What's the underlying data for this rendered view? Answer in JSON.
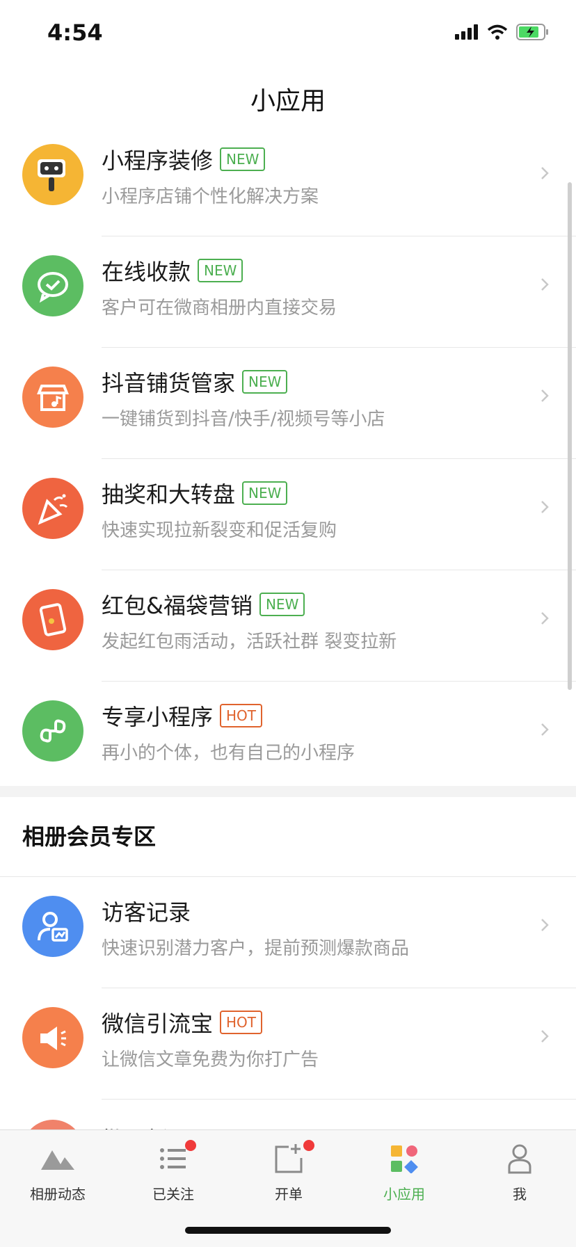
{
  "status": {
    "time": "4:54"
  },
  "page_title": "小应用",
  "apps": [
    {
      "name": "小程序装修",
      "badge": "NEW",
      "badge_type": "new",
      "desc": "小程序店铺个性化解决方案",
      "color": "#f5b534",
      "icon": "robot-icon"
    },
    {
      "name": "在线收款",
      "badge": "NEW",
      "badge_type": "new",
      "desc": "客户可在微商相册内直接交易",
      "color": "#5cbd62",
      "icon": "chat-check-icon"
    },
    {
      "name": "抖音铺货管家",
      "badge": "NEW",
      "badge_type": "new",
      "desc": "一键铺货到抖音/快手/视频号等小店",
      "color": "#f5804c",
      "icon": "shop-music-icon"
    },
    {
      "name": "抽奖和大转盘",
      "badge": "NEW",
      "badge_type": "new",
      "desc": "快速实现拉新裂变和促活复购",
      "color": "#ef6440",
      "icon": "party-popper-icon"
    },
    {
      "name": "红包&福袋营销",
      "badge": "NEW",
      "badge_type": "new",
      "desc": "发起红包雨活动，活跃社群 裂变拉新",
      "color": "#ef6440",
      "icon": "red-envelope-icon"
    },
    {
      "name": "专享小程序",
      "badge": "HOT",
      "badge_type": "hot",
      "desc": "再小的个体，也有自己的小程序",
      "color": "#5cbd62",
      "icon": "mini-program-icon"
    }
  ],
  "section_title": "相册会员专区",
  "member_apps": [
    {
      "name": "访客记录",
      "badge": "",
      "badge_type": "",
      "desc": "快速识别潜力客户，提前预测爆款商品",
      "color": "#4f8ef0",
      "icon": "visitor-chart-icon"
    },
    {
      "name": "微信引流宝",
      "badge": "HOT",
      "badge_type": "hot",
      "desc": "让微信文章免费为你打广告",
      "color": "#f5804c",
      "icon": "megaphone-icon"
    }
  ],
  "peek_item": {
    "name": "批量新页"
  },
  "tabs": [
    {
      "label": "相册动态",
      "icon": "mountain-icon",
      "active": false,
      "dot": false
    },
    {
      "label": "已关注",
      "icon": "list-icon",
      "active": false,
      "dot": true
    },
    {
      "label": "开单",
      "icon": "new-order-icon",
      "active": false,
      "dot": true
    },
    {
      "label": "小应用",
      "icon": "apps-icon",
      "active": true,
      "dot": false
    },
    {
      "label": "我",
      "icon": "user-icon",
      "active": false,
      "dot": false
    }
  ]
}
